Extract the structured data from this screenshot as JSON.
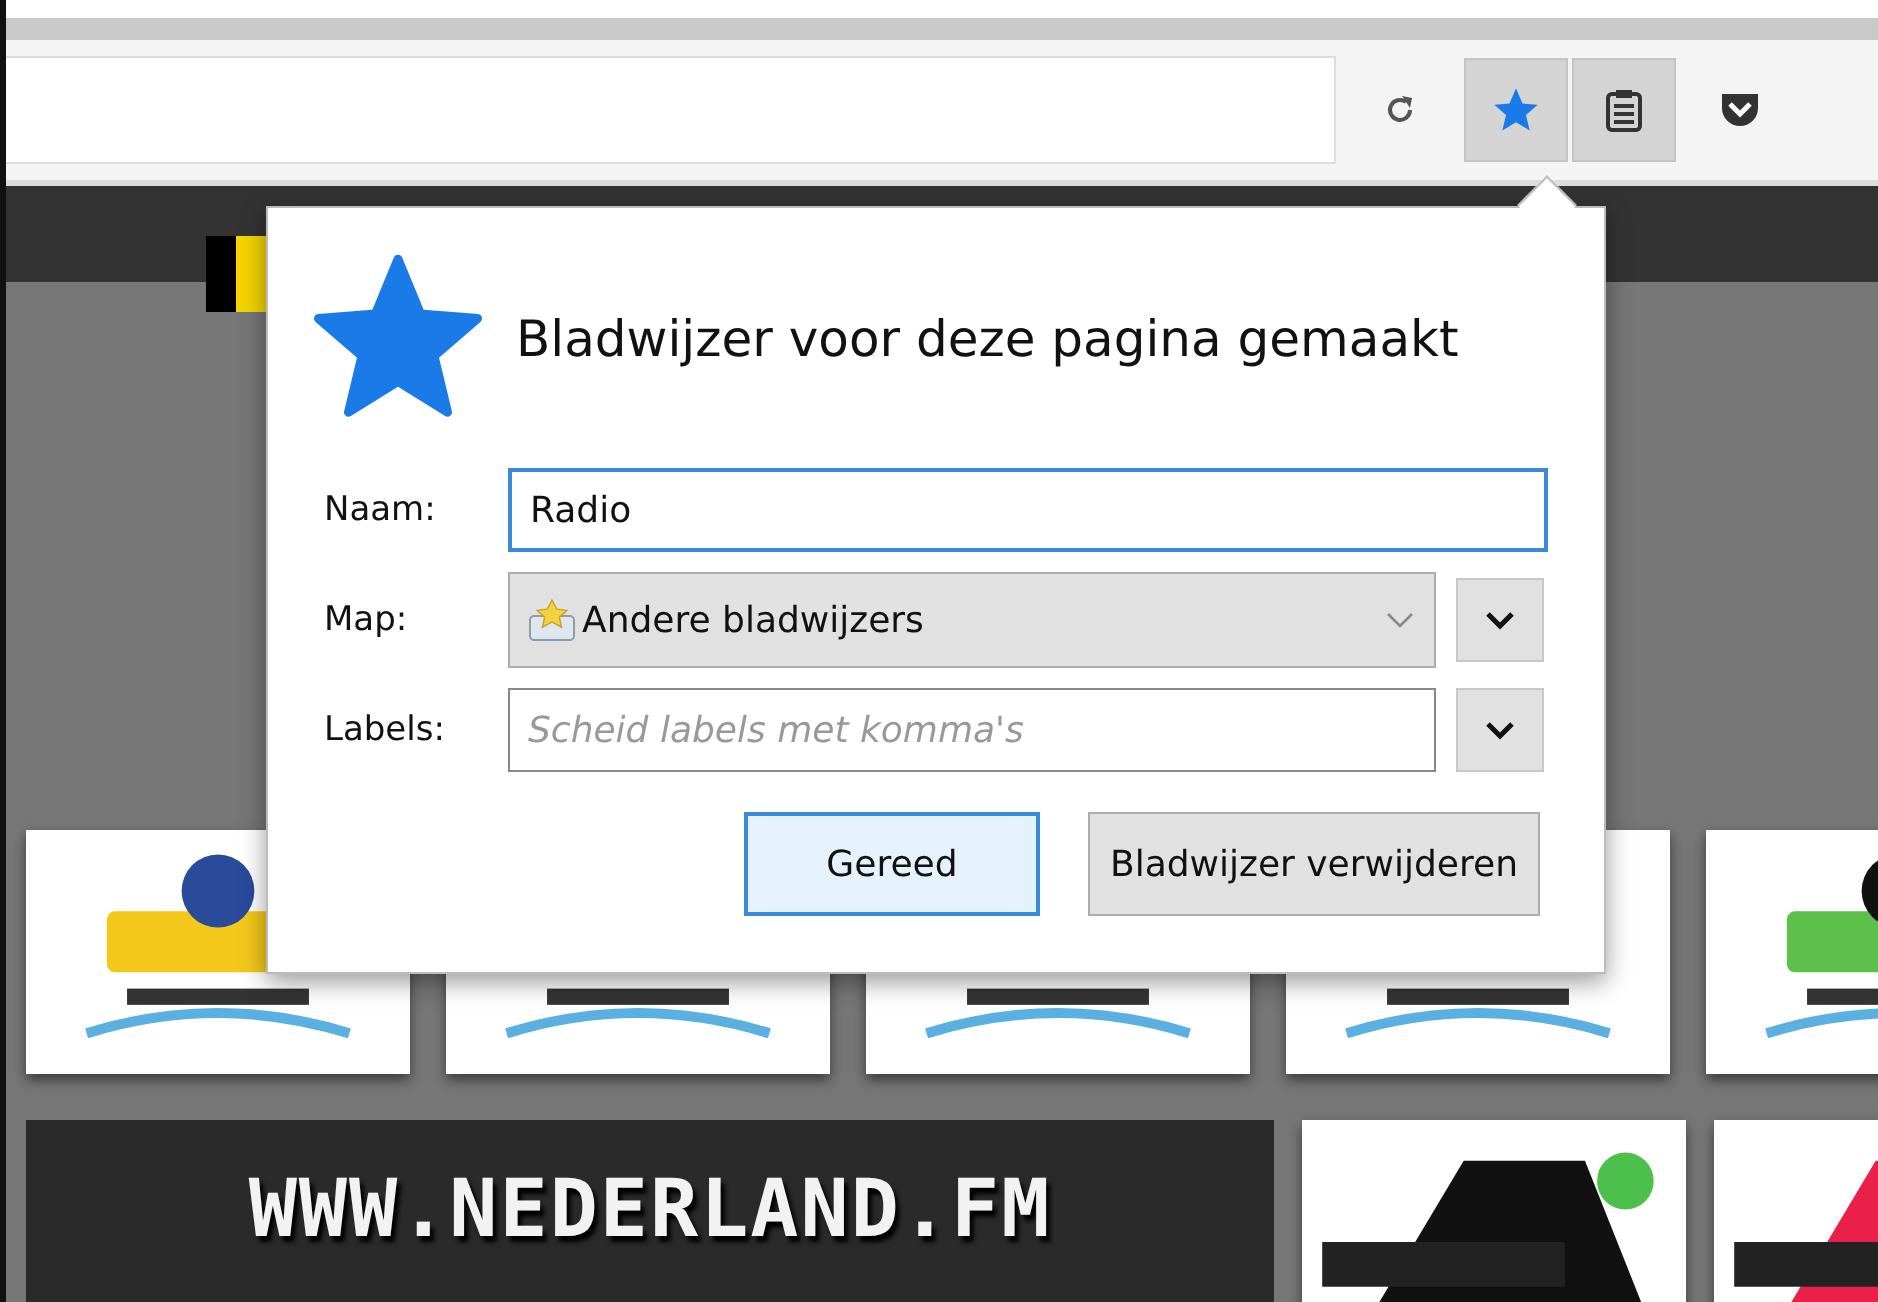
{
  "toolbar": {
    "buttons": [
      {
        "kind": "reload",
        "selected": false
      },
      {
        "kind": "bookmark",
        "selected": true
      },
      {
        "kind": "reading-list",
        "selected": true
      },
      {
        "kind": "pocket",
        "selected": false
      }
    ]
  },
  "page": {
    "banner": {
      "text": "WWW.NEDERLAND.FM"
    }
  },
  "popup": {
    "title": "Bladwijzer voor deze pagina gemaakt",
    "fields": [
      {
        "kind": "text",
        "label": "Naam:",
        "value": "Radio"
      },
      {
        "kind": "select",
        "label": "Map:",
        "value": "Andere bladwijzers"
      },
      {
        "kind": "tags",
        "label": "Labels:",
        "placeholder": "Scheid labels met komma's"
      }
    ],
    "buttons": [
      {
        "label": "Gereed",
        "default": true
      },
      {
        "label": "Bladwijzer verwijderen",
        "default": false
      }
    ]
  }
}
